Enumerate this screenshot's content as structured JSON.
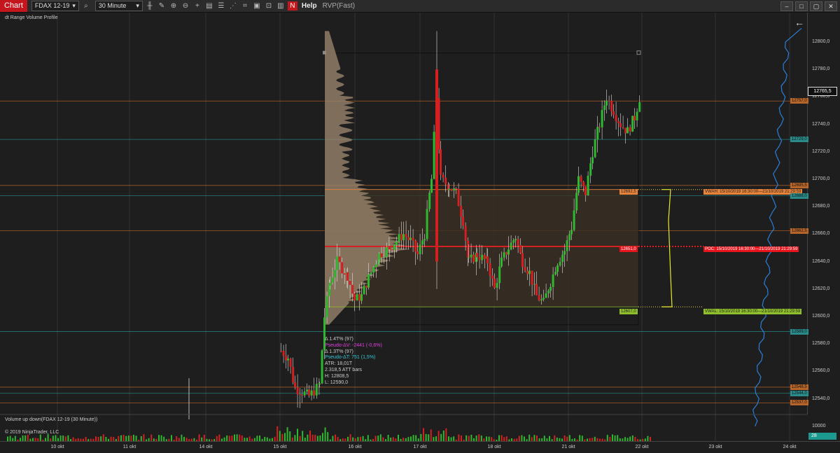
{
  "toolbar": {
    "app_button": "Chart",
    "instrument": "FDAX 12-19",
    "interval": "30 Minute",
    "help": "Help",
    "tool": "RVP(Fast)",
    "window_buttons": [
      "–",
      "□",
      "▢",
      "✕"
    ]
  },
  "indicator": {
    "name": "dt Range Volume Profile"
  },
  "price_axis": {
    "ticks": [
      "12800,0",
      "12780,0",
      "12760,0",
      "12740,0",
      "12720,0",
      "12700,0",
      "12680,0",
      "12660,0",
      "12640,0",
      "12620,0",
      "12600,0",
      "12580,0",
      "12560,0",
      "12540,0"
    ],
    "current_price": "12765,5"
  },
  "levels": {
    "vwah": {
      "tag": "12692,5",
      "label": "VWAH: 15/10/2019 16:30:00—21/10/2019 21:29:59",
      "color": "#e8833a"
    },
    "poc": {
      "tag": "12651,0",
      "label": "POC: 15/10/2019 16:30:00—21/10/2019 21:29:59",
      "color": "#e8141c"
    },
    "vwal": {
      "tag": "12607,0",
      "label": "VWAL: 15/10/2019 16:30:00—21/10/2019 21:29:59",
      "color": "#8fbf2a"
    },
    "right_tags": [
      "12757,0",
      "12729,0",
      "12695,5",
      "12688,0",
      "12662,5",
      "12589,0",
      "12548,5",
      "12544,0",
      "12537,0"
    ]
  },
  "info_box": [
    {
      "text": "Δ 1.4T% (97)",
      "color": "#cccccc"
    },
    {
      "text": "Pseudo-ΔV: -2441 (-0,6%)",
      "color": "#e040e0"
    },
    {
      "text": "Δ 1.3T% (97)",
      "color": "#cccccc"
    },
    {
      "text": "Pseudo-ΔT: 751 (1,5%)",
      "color": "#36c6d6"
    },
    {
      "text": "ATR: 18,01T",
      "color": "#cccccc"
    },
    {
      "text": "2.318,5 ATT bars",
      "color": "#cccccc"
    },
    {
      "text": "H: 12808,5",
      "color": "#cccccc"
    },
    {
      "text": "L: 12590,0",
      "color": "#cccccc"
    }
  ],
  "volume_panel": {
    "label": "Volume up down(FDAX 12-19 (30 Minute))",
    "axis_tick": "10000",
    "badge": "28"
  },
  "copyright": "© 2019 NinjaTrader, LLC",
  "date_axis": [
    "10 okt",
    "11 okt",
    "14 okt",
    "15 okt",
    "16 okt",
    "17 okt",
    "18 okt",
    "21 okt",
    "22 okt",
    "23 okt",
    "24 okt"
  ],
  "colors": {
    "up": "#2fb82f",
    "down": "#d42020",
    "profile": "#a08a70",
    "value_area": "#3a2f24",
    "vwap_line": "#2b7fd6",
    "orange_line": "#b8652a",
    "teal_line": "#2a8b8b"
  }
}
